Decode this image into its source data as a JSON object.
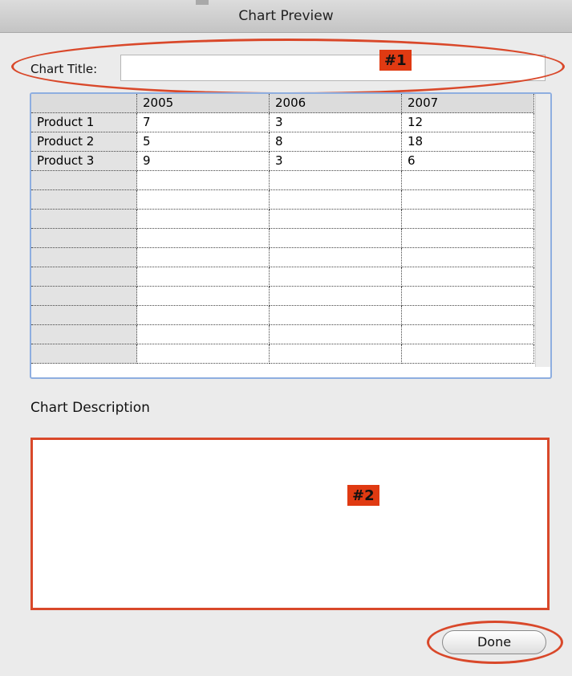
{
  "window": {
    "title": "Chart Preview"
  },
  "chart_title": {
    "label": "Chart Title:",
    "value": ""
  },
  "table": {
    "columns": [
      "",
      "2005",
      "2006",
      "2007"
    ],
    "rows": [
      [
        "Product 1",
        "7",
        "3",
        "12"
      ],
      [
        "Product 2",
        "5",
        "8",
        "18"
      ],
      [
        "Product 3",
        "9",
        "3",
        "6"
      ],
      [
        "",
        "",
        "",
        ""
      ],
      [
        "",
        "",
        "",
        ""
      ],
      [
        "",
        "",
        "",
        ""
      ],
      [
        "",
        "",
        "",
        ""
      ],
      [
        "",
        "",
        "",
        ""
      ],
      [
        "",
        "",
        "",
        ""
      ],
      [
        "",
        "",
        "",
        ""
      ],
      [
        "",
        "",
        "",
        ""
      ],
      [
        "",
        "",
        "",
        ""
      ],
      [
        "",
        "",
        "",
        ""
      ]
    ]
  },
  "description": {
    "label": "Chart Description",
    "value": ""
  },
  "buttons": {
    "done": "Done"
  },
  "annotations": {
    "tag1": "#1",
    "tag2": "#2"
  },
  "colors": {
    "annotation": "#d9482a",
    "tag_bg": "#e03a12",
    "table_focus": "#8eaee0"
  }
}
